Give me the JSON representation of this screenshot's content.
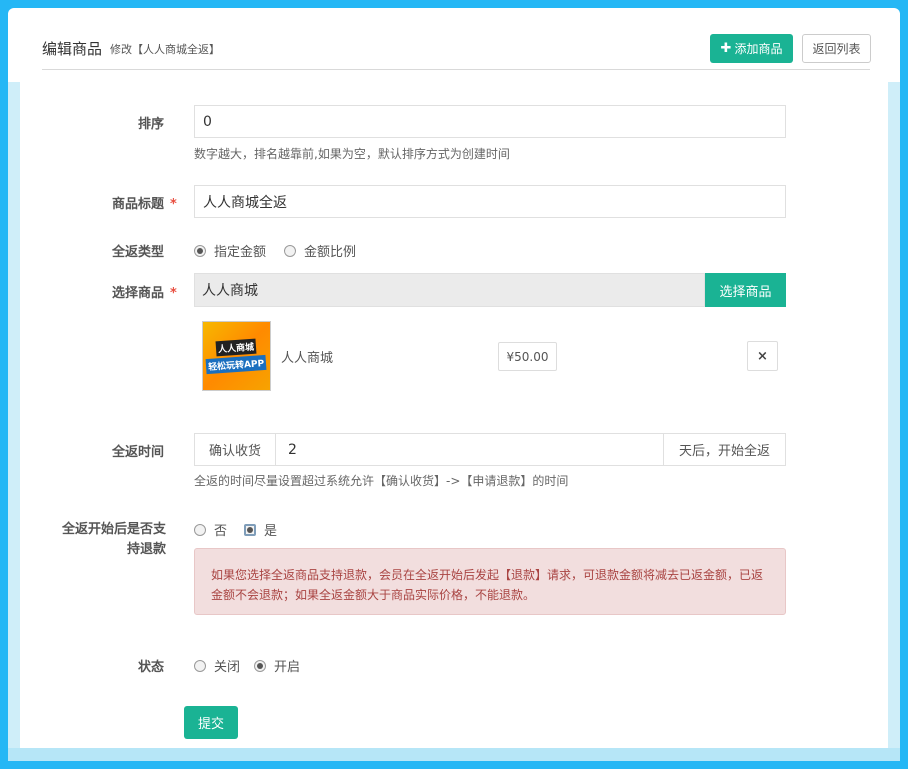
{
  "header": {
    "title": "编辑商品",
    "subtitle": "修改【人人商城全返】",
    "add_button": "添加商品",
    "back_button": "返回列表"
  },
  "form": {
    "sort": {
      "label": "排序",
      "value": "0",
      "help": "数字越大，排名越靠前,如果为空，默认排序方式为创建时间"
    },
    "goods_title": {
      "label": "商品标题",
      "required_mark": "*",
      "value": "人人商城全返"
    },
    "return_type": {
      "label": "全返类型",
      "options": [
        "指定金额",
        "金额比例"
      ],
      "selected": "指定金额"
    },
    "select_goods": {
      "label": "选择商品",
      "required_mark": "*",
      "value": "人人商城",
      "button": "选择商品",
      "item": {
        "thumb_line1": "人人商城",
        "thumb_line2": "轻松玩转APP",
        "name": "人人商城",
        "price": "¥50.00",
        "remove_icon": "×"
      }
    },
    "return_time": {
      "label": "全返时间",
      "prefix": "确认收货",
      "value": "2",
      "suffix": "天后，开始全返",
      "help": "全返的时间尽量设置超过系统允许【确认收货】->【申请退款】的时间"
    },
    "refund_support": {
      "label_line1": "全返开始后是否支",
      "label_line2": "持退款",
      "options": [
        "否",
        "是"
      ],
      "selected": "是",
      "alert": "如果您选择全返商品支持退款，会员在全返开始后发起【退款】请求，可退款金额将减去已返金额，已返金额不会退款；如果全返金额大于商品实际价格，不能退款。"
    },
    "status": {
      "label": "状态",
      "options": [
        "关闭",
        "开启"
      ],
      "selected": "开启"
    },
    "submit": "提交"
  },
  "colors": {
    "frame": "#25b7f5",
    "primary": "#1ab394",
    "alert_bg": "#f2dede",
    "alert_text": "#a94442"
  }
}
